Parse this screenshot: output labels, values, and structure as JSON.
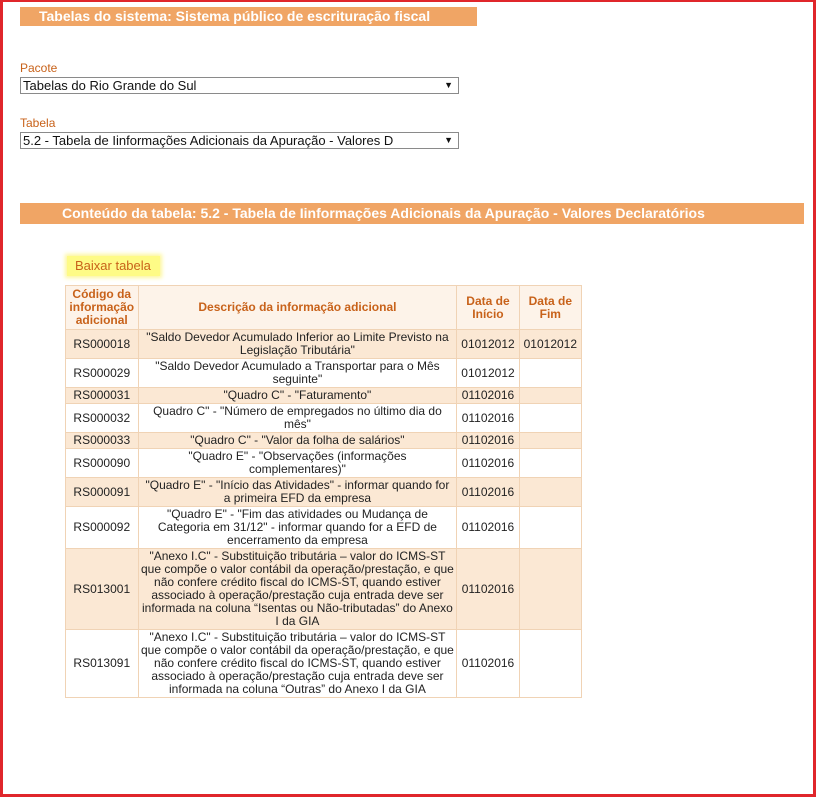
{
  "header1": "Tabelas do sistema: Sistema público de escrituração fiscal",
  "form": {
    "pacote_label": "Pacote",
    "pacote_value": "Tabelas do Rio Grande do Sul",
    "tabela_label": "Tabela",
    "tabela_value": "5.2 - Tabela de Iinformações Adicionais da Apuração - Valores D"
  },
  "header2": "Conteúdo da tabela: 5.2 - Tabela de Iinformações Adicionais da Apuração - Valores Declaratórios",
  "download_label": "Baixar tabela",
  "table": {
    "columns": [
      "Código da informação adicional",
      "Descrição da informação adicional",
      "Data de Início",
      "Data de Fim"
    ],
    "rows": [
      {
        "code": "RS000018",
        "desc": "\"Saldo Devedor Acumulado Inferior ao Limite Previsto na Legislação Tributária\"",
        "start": "01012012",
        "end": "01012012"
      },
      {
        "code": "RS000029",
        "desc": "\"Saldo Devedor Acumulado a Transportar para o Mês seguinte\"",
        "start": "01012012",
        "end": ""
      },
      {
        "code": "RS000031",
        "desc": "\"Quadro C\" - \"Faturamento\"",
        "start": "01102016",
        "end": ""
      },
      {
        "code": "RS000032",
        "desc": "Quadro C\" - \"Número de empregados no último dia do mês\"",
        "start": "01102016",
        "end": ""
      },
      {
        "code": "RS000033",
        "desc": "\"Quadro C\" - \"Valor da folha de salários\"",
        "start": "01102016",
        "end": ""
      },
      {
        "code": "RS000090",
        "desc": "\"Quadro E\" - \"Observações (informações complementares)\"",
        "start": "01102016",
        "end": ""
      },
      {
        "code": "RS000091",
        "desc": "\"Quadro E\" - \"Início das Atividades\" - informar quando for a primeira EFD da empresa",
        "start": "01102016",
        "end": ""
      },
      {
        "code": "RS000092",
        "desc": "\"Quadro E\" - \"Fim das atividades ou Mudança de Categoria em 31/12\" - informar quando for a EFD de encerramento da empresa",
        "start": "01102016",
        "end": ""
      },
      {
        "code": "RS013001",
        "desc": "\"Anexo I.C\" - Substituição tributária – valor do ICMS-ST que compõe o valor contábil da operação/prestação, e que não confere crédito fiscal do ICMS-ST, quando estiver associado à operação/prestação cuja entrada deve ser informada na coluna “Isentas ou Não-tributadas” do Anexo I da GIA",
        "start": "01102016",
        "end": ""
      },
      {
        "code": "RS013091",
        "desc": "\"Anexo I.C\" - Substituição tributária – valor do ICMS-ST que compõe o valor contábil da operação/prestação, e que não confere crédito fiscal do ICMS-ST, quando estiver associado à operação/prestação cuja entrada deve ser informada na coluna “Outras” do Anexo I da GIA",
        "start": "01102016",
        "end": ""
      }
    ]
  }
}
